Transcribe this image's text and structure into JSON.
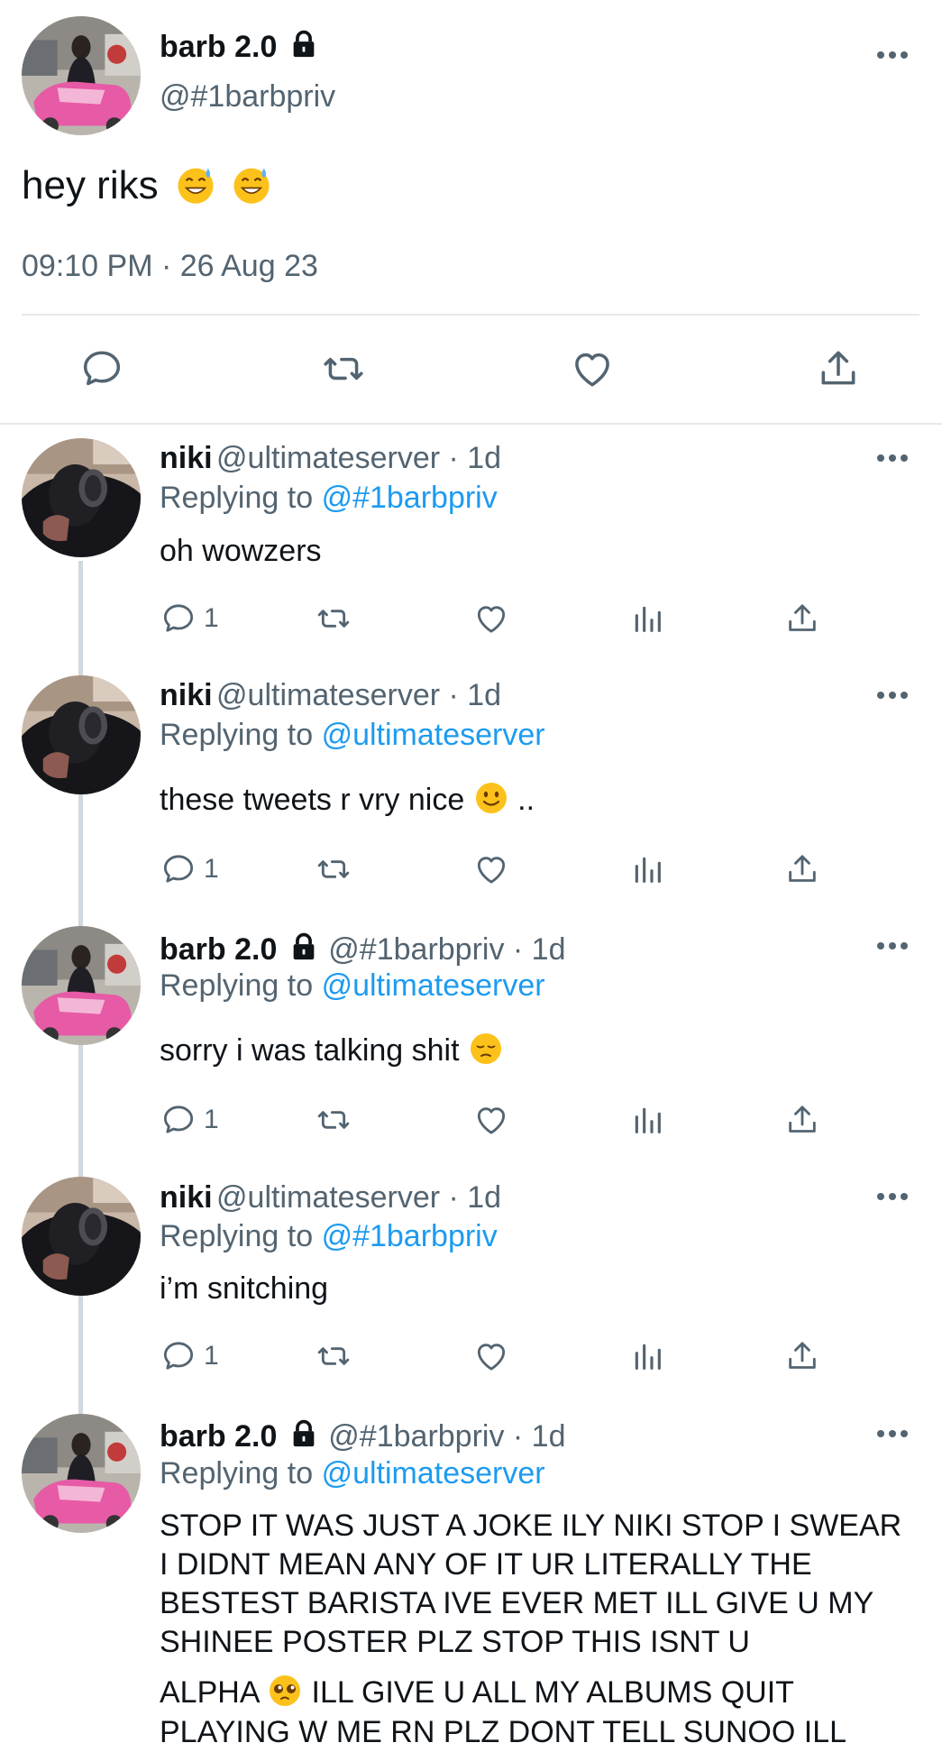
{
  "main_tweet": {
    "name": "barb 2.0",
    "handle": "@#1barbpriv",
    "text": "hey riks",
    "timestamp": "09:10 PM · 26 Aug 23"
  },
  "replies": [
    {
      "name": "niki",
      "meta": "@ultimateserver · 1d",
      "replying_label": "Replying to",
      "replying_to": "@#1barbpriv",
      "text": "oh wowzers",
      "reply_count": "1"
    },
    {
      "name": "niki",
      "meta": "@ultimateserver · 1d",
      "replying_label": "Replying to",
      "replying_to": "@ultimateserver",
      "text": "these tweets r vry nice",
      "text_tail": "..",
      "reply_count": "1"
    },
    {
      "name": "barb 2.0",
      "meta": "@#1barbpriv · 1d",
      "replying_label": "Replying to",
      "replying_to": "@ultimateserver",
      "text": "sorry i was talking shit",
      "reply_count": "1"
    },
    {
      "name": "niki",
      "meta": "@ultimateserver · 1d",
      "replying_label": "Replying to",
      "replying_to": "@#1barbpriv",
      "text": "i’m snitching",
      "reply_count": "1"
    },
    {
      "name": "barb 2.0",
      "meta": "@#1barbpriv · 1d",
      "replying_label": "Replying to",
      "replying_to": "@ultimateserver",
      "text": "STOP IT WAS JUST A JOKE ILY NIKI STOP I SWEAR I DIDNT MEAN ANY OF IT UR LITERALLY THE BESTEST BARISTA IVE EVER MET ILL GIVE U MY SHINEE POSTER PLZ STOP THIS ISNT U",
      "text2_a": "ALPHA",
      "text2_b": "ILL GIVE U ALL MY ALBUMS QUIT",
      "text3": "PLAYING W ME RN PLZ DONT TELL SUNOO ILL"
    }
  ],
  "icons": {
    "reply": "reply-bubble-icon",
    "retweet": "retweet-icon",
    "like": "heart-icon",
    "views": "views-chart-icon",
    "share": "share-upload-icon",
    "more": "more-dots-icon",
    "lock": "lock-icon"
  },
  "colors": {
    "accent": "#1d9bf0",
    "muted": "#536471",
    "text": "#0f1419",
    "divider": "#cfd9de",
    "pink_car": "#e75aa6"
  }
}
